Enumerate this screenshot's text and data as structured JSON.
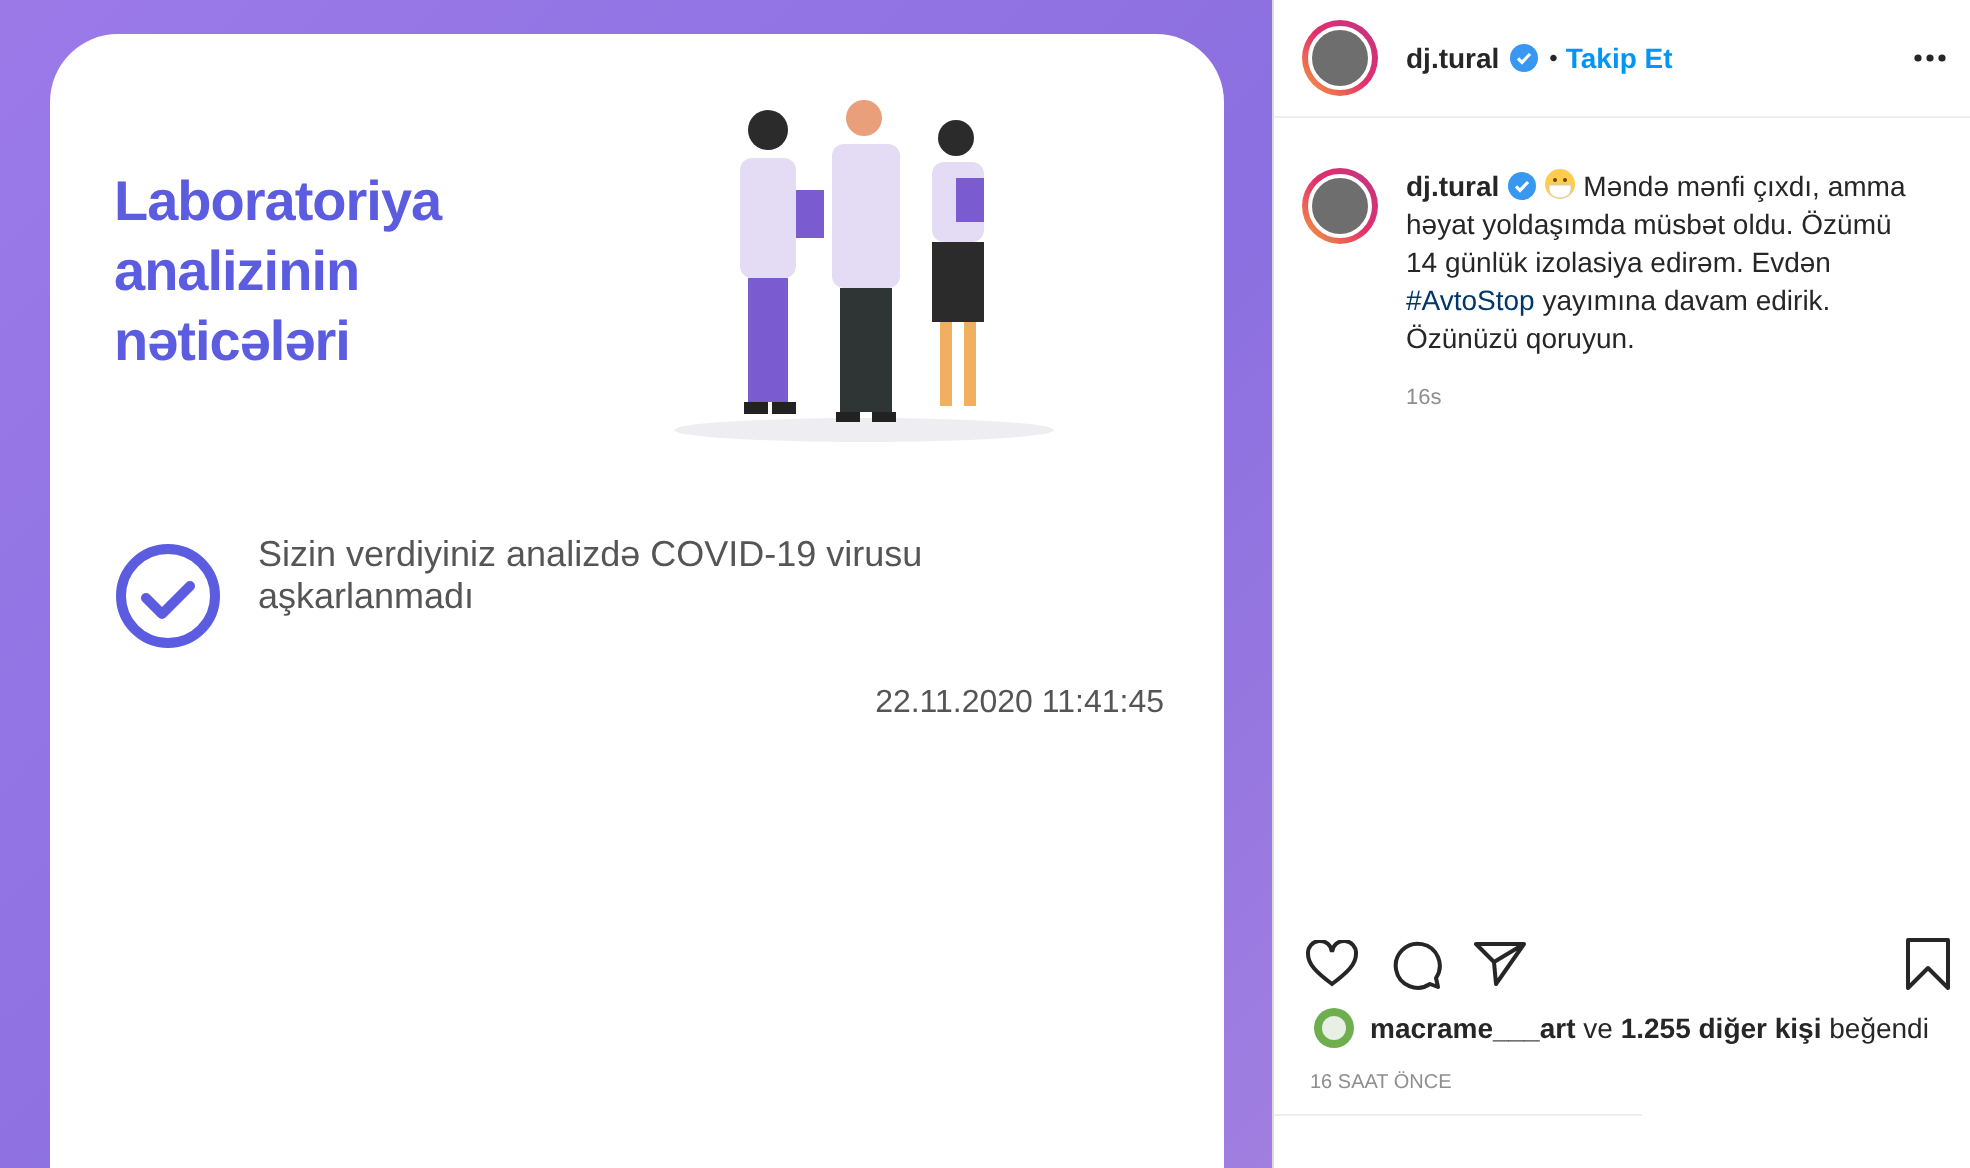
{
  "post_image": {
    "title_lines": [
      "Laboratoriya",
      "analizinin",
      "nəticələri"
    ],
    "result": "Sizin verdiyiniz analizdə COVID-19 virusu aşkarlanmadı",
    "timestamp": "22.11.2020 11:41:45"
  },
  "header": {
    "username": "dj.tural",
    "verified": true,
    "separator": "•",
    "follow": "Takip Et"
  },
  "caption": {
    "username": "dj.tural",
    "verified": true,
    "text": "Məndə mənfi çıxdı, amma həyat yoldaşımda müsbət oldu. Özümü 14 günlük izolasiya edirəm. Evdən ",
    "hashtag": "#AvtoStop",
    "text_end": " yayımına davam edirik. Özünüzü qoruyun.",
    "age": "16s"
  },
  "likes": "**macrame___art** ve **1.255 diğer kişi** beğendi",
  "time": "16 SAAT ÖNCE"
}
